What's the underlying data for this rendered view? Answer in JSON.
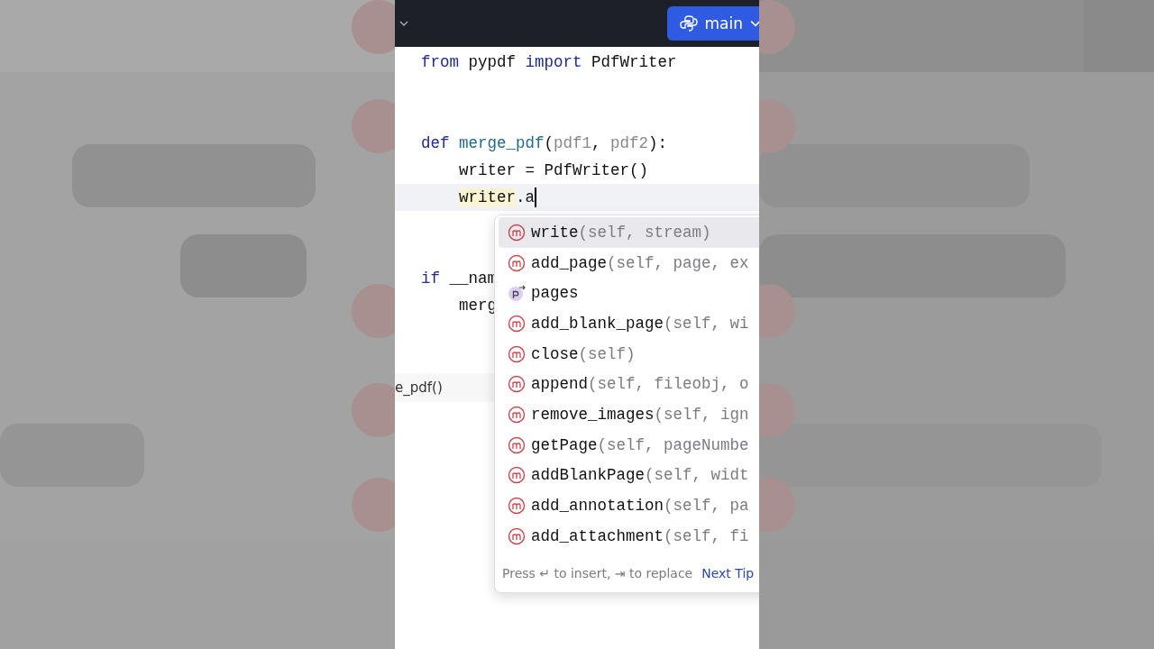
{
  "toolbar": {
    "branch_button": {
      "label": "main"
    }
  },
  "editor": {
    "blocks": [
      [
        {
          "tokens": [
            {
              "kind": "keyword",
              "text": "from"
            },
            {
              "kind": "plain",
              "text": " pypdf "
            },
            {
              "kind": "keyword",
              "text": "import"
            },
            {
              "kind": "plain",
              "text": " PdfWriter"
            }
          ],
          "indented": false,
          "current": false
        }
      ],
      [
        {
          "tokens": [
            {
              "kind": "keyword",
              "text": "def"
            },
            {
              "kind": "func",
              "text": " merge_pdf"
            },
            {
              "kind": "plain",
              "text": "("
            },
            {
              "kind": "param",
              "text": "pdf1"
            },
            {
              "kind": "plain",
              "text": ", "
            },
            {
              "kind": "param",
              "text": "pdf2"
            },
            {
              "kind": "plain",
              "text": "):"
            }
          ],
          "indented": false,
          "current": false
        },
        {
          "tokens": [
            {
              "kind": "plain",
              "text": "writer = PdfWriter()"
            }
          ],
          "indented": true,
          "current": false
        },
        {
          "tokens": [
            {
              "kind": "highlight",
              "text": "writer"
            },
            {
              "kind": "plain",
              "text": ".a"
            }
          ],
          "indented": true,
          "current": true,
          "cursor": true
        }
      ],
      [
        {
          "tokens": [
            {
              "kind": "keyword",
              "text": "if"
            },
            {
              "kind": "plain",
              "text": " __nam"
            }
          ],
          "indented": false,
          "current": false
        },
        {
          "tokens": [
            {
              "kind": "plain",
              "text": "merg"
            }
          ],
          "indented": true,
          "current": false
        }
      ]
    ],
    "breadcrumb": "e_pdf()"
  },
  "completion": {
    "items": [
      {
        "kind": "method",
        "name": "write",
        "signature": "(self, stream)",
        "selected": true
      },
      {
        "kind": "method",
        "name": "add_page",
        "signature": "(self, page, ex",
        "selected": false
      },
      {
        "kind": "property",
        "name": "pages",
        "selected": false
      },
      {
        "kind": "method",
        "name": "add_blank_page",
        "signature": "(self, wi",
        "selected": false
      },
      {
        "kind": "method",
        "name": "close",
        "signature": "(self)",
        "selected": false
      },
      {
        "kind": "method",
        "name": "append",
        "signature": "(self, fileobj, o",
        "selected": false
      },
      {
        "kind": "method",
        "name": "remove_images",
        "signature": "(self, ign",
        "selected": false
      },
      {
        "kind": "method",
        "name": "getPage",
        "signature": "(self, pageNumbe",
        "selected": false
      },
      {
        "kind": "method",
        "name": "addBlankPage",
        "signature": "(self, widt",
        "selected": false
      },
      {
        "kind": "method",
        "name": "add_annotation",
        "signature": "(self, pa",
        "selected": false
      },
      {
        "kind": "method",
        "name": "add_attachment",
        "signature": "(self, fi",
        "selected": false
      }
    ],
    "hint": "Press ↵ to insert, ⇥ to replace",
    "next_tip": "Next Tip"
  }
}
